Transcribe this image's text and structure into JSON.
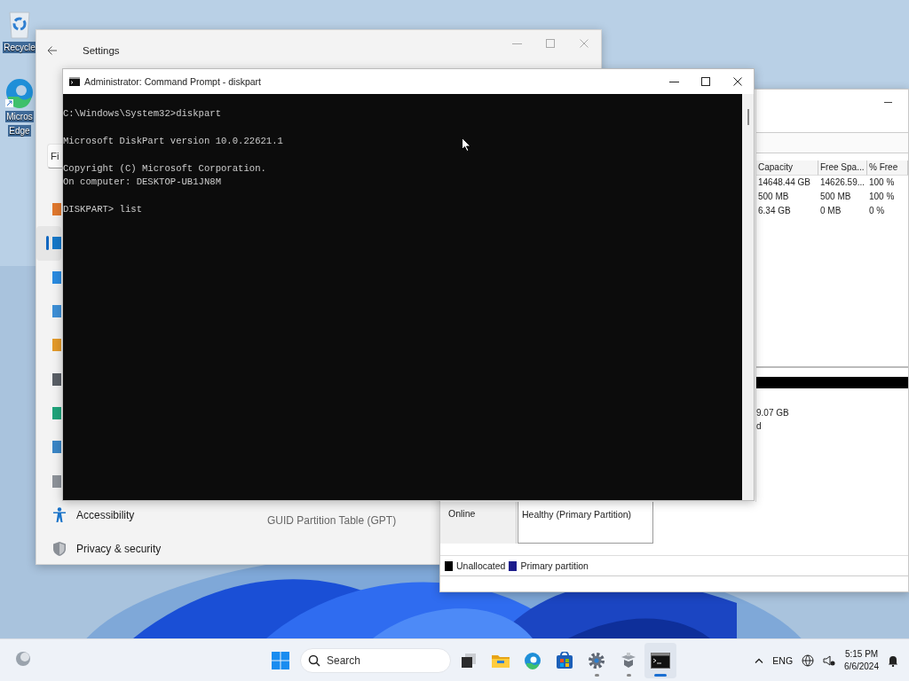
{
  "desktop": {
    "icons": [
      {
        "kind": "recycle",
        "label_lines": [
          "Recycle"
        ]
      },
      {
        "kind": "edge",
        "label_lines": [
          "Micros",
          "Edge"
        ]
      }
    ]
  },
  "settings_window": {
    "title": "Settings",
    "search": {
      "placeholder": "Fi"
    },
    "nav_items": [
      {
        "kind": "tile",
        "color": "#e0782e",
        "selected": false
      },
      {
        "kind": "tile",
        "color": "#1577c8",
        "selected": true
      },
      {
        "kind": "tile",
        "color": "#2a8be0",
        "selected": false
      },
      {
        "kind": "tile",
        "color": "#3d8fd6",
        "selected": false
      },
      {
        "kind": "tile",
        "color": "#e39a2a",
        "selected": false
      },
      {
        "kind": "tile",
        "color": "#5a5f66",
        "selected": false
      },
      {
        "kind": "tile",
        "color": "#1ea37a",
        "selected": false
      },
      {
        "kind": "tile",
        "color": "#3a86c6",
        "selected": false
      },
      {
        "kind": "tile",
        "color": "#8d9299",
        "selected": false
      },
      {
        "kind": "person",
        "color": "#1a73c8",
        "label": "Accessibility",
        "selected": false
      },
      {
        "kind": "shield",
        "color": "#8a8f96",
        "label": "Privacy & security",
        "selected": false
      }
    ],
    "content_text": "GUID Partition Table (GPT)"
  },
  "disk_management_window": {
    "columns": [
      "Capacity",
      "Free Spa...",
      "% Free"
    ],
    "rows": [
      [
        "14648.44 GB",
        "14626.59...",
        "100 %"
      ],
      [
        "500 MB",
        "500 MB",
        "100 %"
      ],
      [
        "6.34 GB",
        "0 MB",
        "0 %"
      ]
    ],
    "partition_lines": [
      "9.07 GB",
      "d"
    ],
    "disk_status": "Online",
    "partition_status": "Healthy (Primary Partition)",
    "legend": [
      {
        "label": "Unallocated",
        "color": "#000000"
      },
      {
        "label": "Primary partition",
        "color": "#1c1c8c"
      }
    ]
  },
  "command_prompt_window": {
    "title": "Administrator: Command Prompt - diskpart",
    "blocks": [
      [
        "C:\\Windows\\System32>diskpart"
      ],
      [
        "Microsoft DiskPart version 10.0.22621.1"
      ],
      [
        "Copyright (C) Microsoft Corporation.",
        "On computer: DESKTOP-UB1JN8M"
      ],
      [
        "DISKPART> list"
      ]
    ]
  },
  "taskbar": {
    "search_placeholder": "Search",
    "apps": [
      {
        "kind": "taskview",
        "running": false,
        "selected": false
      },
      {
        "kind": "folder",
        "running": false,
        "selected": false
      },
      {
        "kind": "edge",
        "running": false,
        "selected": false
      },
      {
        "kind": "store",
        "running": false,
        "selected": false
      },
      {
        "kind": "settings",
        "running": true,
        "selected": false
      },
      {
        "kind": "tool",
        "running": true,
        "selected": false
      },
      {
        "kind": "terminal",
        "running": true,
        "selected": true
      }
    ],
    "language": "ENG",
    "time": "5:15 PM",
    "date": "6/6/2024"
  }
}
